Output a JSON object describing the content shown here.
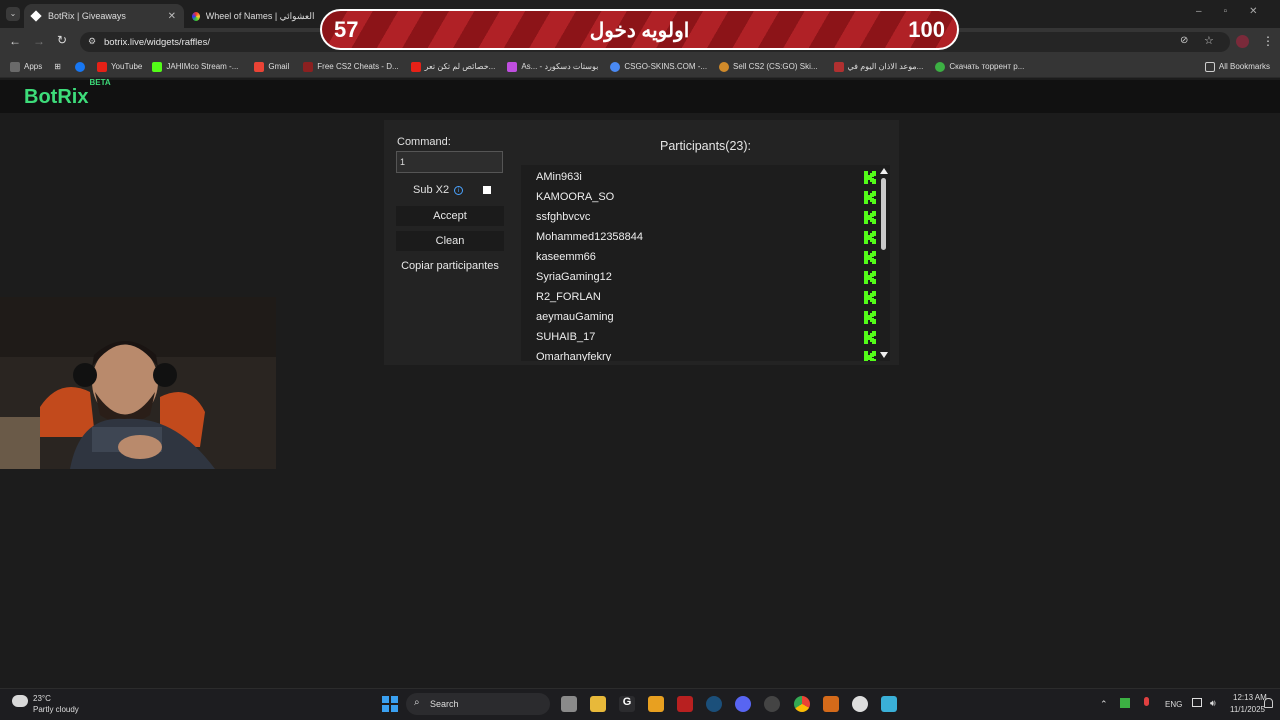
{
  "browser": {
    "tabs": [
      {
        "title": "BotRix | Giveaways",
        "active": true
      },
      {
        "title": "Wheel of Names | اسم العشوائي",
        "active": false
      }
    ],
    "url": "botrix.live/widgets/raffles/",
    "bookmarks": [
      {
        "label": "Apps",
        "color": "#4a8af4"
      },
      {
        "label": "YouTube",
        "color": "#e62117"
      },
      {
        "label": "JAHIMco Stream -...",
        "color": "#53fc18"
      },
      {
        "label": "Gmail",
        "color": "#ea4335"
      },
      {
        "label": "Free CS2 Cheats - D...",
        "color": "#8b2020"
      },
      {
        "label": "خصائص لم تكن تعر...",
        "color": "#e62117"
      },
      {
        "label": "As... - بوستات دسكورد",
        "color": "#c04ee0"
      },
      {
        "label": "CSGO-SKINS.COM -...",
        "color": "#4a8af4"
      },
      {
        "label": "Sell CS2 (CS:GO) Ski...",
        "color": "#d08a2a"
      },
      {
        "label": "موعد الاذان اليوم في...",
        "color": "#b03030"
      },
      {
        "label": "Скачать торрент р...",
        "color": "#3cb043"
      }
    ],
    "all_bookmarks": "All Bookmarks"
  },
  "overlay": {
    "left_number": "57",
    "title": "اولويه دخول",
    "right_number": "100"
  },
  "app": {
    "logo": "BotRix",
    "logo_badge": "BETA",
    "command_label": "Command:",
    "command_value": "1",
    "sub_label": "Sub X2",
    "accept_label": "Accept",
    "clean_label": "Clean",
    "copy_label": "Copiar participantes",
    "participants_title": "Participants(23):",
    "participants": [
      "AMin963i",
      "KAMOORA_SO",
      "ssfghbvcvc",
      "Mohammed12358844",
      "kaseemm66",
      "SyriaGaming12",
      "R2_FORLAN",
      "aeymauGaming",
      "SUHAIB_17",
      "Omarhanyfekry"
    ]
  },
  "taskbar": {
    "temperature": "23°C",
    "weather": "Partly cloudy",
    "search": "Search",
    "language": "ENG",
    "time": "12:13 AM",
    "date": "11/1/2025"
  }
}
